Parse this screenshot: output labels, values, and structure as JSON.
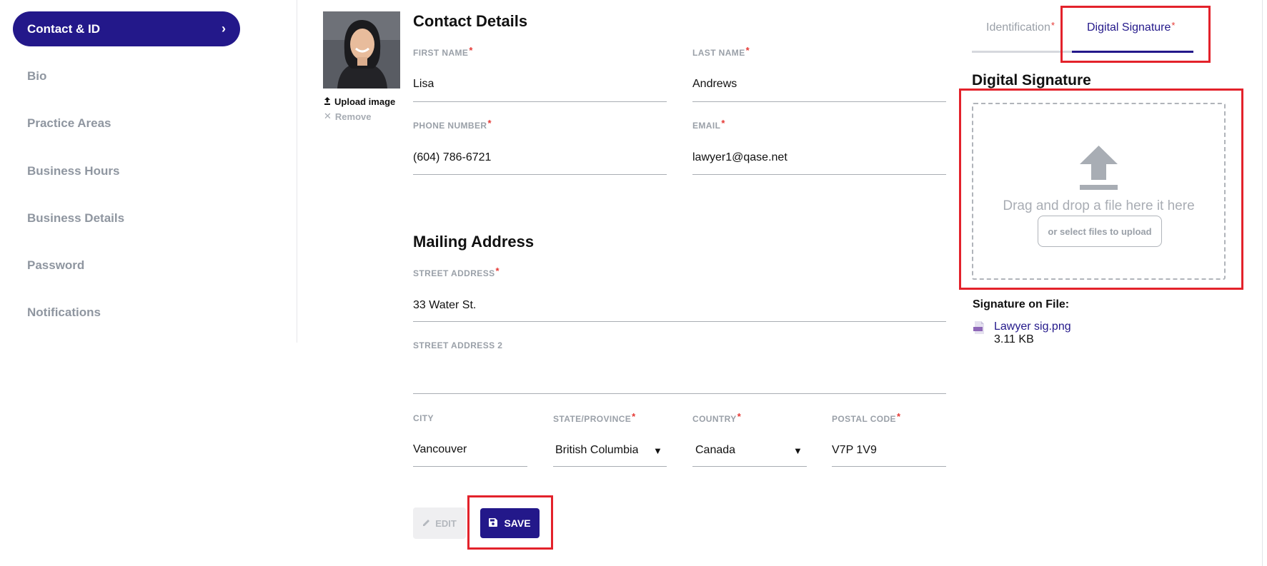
{
  "sidebar": {
    "active": "Contact & ID",
    "items": [
      "Bio",
      "Practice Areas",
      "Business Hours",
      "Business Details",
      "Password",
      "Notifications"
    ]
  },
  "photo": {
    "upload_label": "Upload image",
    "remove_label": "Remove"
  },
  "contact": {
    "title": "Contact Details",
    "first_name": {
      "label": "FIRST NAME",
      "value": "Lisa"
    },
    "last_name": {
      "label": "LAST NAME",
      "value": "Andrews"
    },
    "phone": {
      "label": "PHONE NUMBER",
      "value": "(604) 786-6721"
    },
    "email": {
      "label": "EMAIL",
      "value": "lawyer1@qase.net"
    }
  },
  "mailing": {
    "title": "Mailing Address",
    "street1": {
      "label": "STREET ADDRESS",
      "value": "33 Water St."
    },
    "street2": {
      "label": "STREET ADDRESS 2",
      "value": ""
    },
    "city": {
      "label": "CITY",
      "value": "Vancouver"
    },
    "state": {
      "label": "STATE/PROVINCE",
      "value": "British Columbia"
    },
    "country": {
      "label": "COUNTRY",
      "value": "Canada"
    },
    "postal": {
      "label": "POSTAL CODE",
      "value": "V7P 1V9"
    }
  },
  "buttons": {
    "edit_label": "EDIT",
    "save_label": "SAVE"
  },
  "right_panel": {
    "tabs": [
      {
        "label": "Identification",
        "active": false
      },
      {
        "label": "Digital Signature",
        "active": true
      }
    ],
    "heading": "Digital Signature",
    "dropzone_text": "Drag and drop a file here it here",
    "select_files_label": "or select files to upload",
    "signature_label": "Signature on File:",
    "file": {
      "name": "Lawyer sig.png",
      "size": "3.11 KB"
    }
  },
  "colors": {
    "brand": "#23188a",
    "required": "#e53935",
    "highlight": "#e3222b",
    "muted": "#9aa0a8"
  },
  "icons": {
    "nav_active": "chevron-right-icon",
    "upload_photo": "upload-icon",
    "remove_photo": "close-icon",
    "edit": "pencil-icon",
    "save": "floppy-disk-icon",
    "dropzone": "upload-arrow-icon",
    "file": "png-file-icon",
    "select": "caret-down-icon"
  }
}
